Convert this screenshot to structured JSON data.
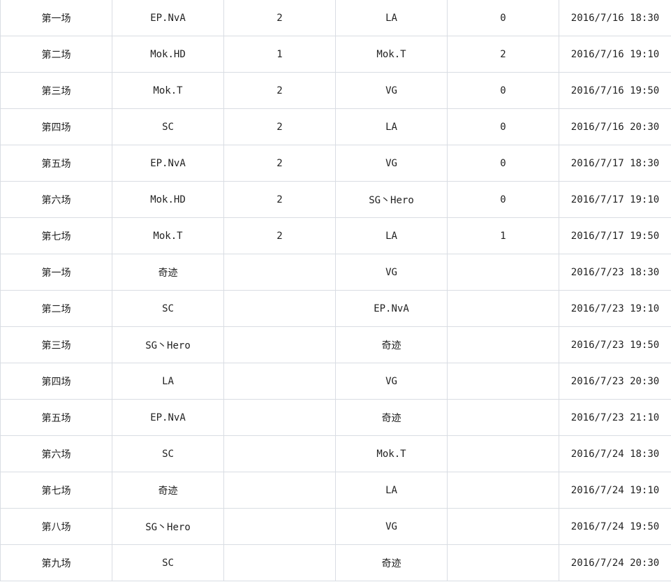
{
  "rows": [
    {
      "round": "第一场",
      "team_a": "EP.NvA",
      "score_a": "2",
      "team_b": "LA",
      "score_b": "0",
      "time": "2016/7/16 18:30"
    },
    {
      "round": "第二场",
      "team_a": "Mok.HD",
      "score_a": "1",
      "team_b": "Mok.T",
      "score_b": "2",
      "time": "2016/7/16 19:10"
    },
    {
      "round": "第三场",
      "team_a": "Mok.T",
      "score_a": "2",
      "team_b": "VG",
      "score_b": "0",
      "time": "2016/7/16 19:50"
    },
    {
      "round": "第四场",
      "team_a": "SC",
      "score_a": "2",
      "team_b": "LA",
      "score_b": "0",
      "time": "2016/7/16 20:30"
    },
    {
      "round": "第五场",
      "team_a": "EP.NvA",
      "score_a": "2",
      "team_b": "VG",
      "score_b": "0",
      "time": "2016/7/17 18:30"
    },
    {
      "round": "第六场",
      "team_a": "Mok.HD",
      "score_a": "2",
      "team_b": "SG丶Hero",
      "score_b": "0",
      "time": "2016/7/17 19:10"
    },
    {
      "round": "第七场",
      "team_a": "Mok.T",
      "score_a": "2",
      "team_b": "LA",
      "score_b": "1",
      "time": "2016/7/17 19:50"
    },
    {
      "round": "第一场",
      "team_a": "奇迹",
      "score_a": "",
      "team_b": "VG",
      "score_b": "",
      "time": "2016/7/23 18:30"
    },
    {
      "round": "第二场",
      "team_a": "SC",
      "score_a": "",
      "team_b": "EP.NvA",
      "score_b": "",
      "time": "2016/7/23 19:10"
    },
    {
      "round": "第三场",
      "team_a": "SG丶Hero",
      "score_a": "",
      "team_b": "奇迹",
      "score_b": "",
      "time": "2016/7/23 19:50"
    },
    {
      "round": "第四场",
      "team_a": "LA",
      "score_a": "",
      "team_b": "VG",
      "score_b": "",
      "time": "2016/7/23 20:30"
    },
    {
      "round": "第五场",
      "team_a": "EP.NvA",
      "score_a": "",
      "team_b": "奇迹",
      "score_b": "",
      "time": "2016/7/23 21:10"
    },
    {
      "round": "第六场",
      "team_a": "SC",
      "score_a": "",
      "team_b": "Mok.T",
      "score_b": "",
      "time": "2016/7/24 18:30"
    },
    {
      "round": "第七场",
      "team_a": "奇迹",
      "score_a": "",
      "team_b": "LA",
      "score_b": "",
      "time": "2016/7/24 19:10"
    },
    {
      "round": "第八场",
      "team_a": "SG丶Hero",
      "score_a": "",
      "team_b": "VG",
      "score_b": "",
      "time": "2016/7/24 19:50"
    },
    {
      "round": "第九场",
      "team_a": "SC",
      "score_a": "",
      "team_b": "奇迹",
      "score_b": "",
      "time": "2016/7/24 20:30"
    }
  ],
  "colors": {
    "border": "#d9dde3",
    "text": "#222222",
    "background": "#ffffff"
  }
}
